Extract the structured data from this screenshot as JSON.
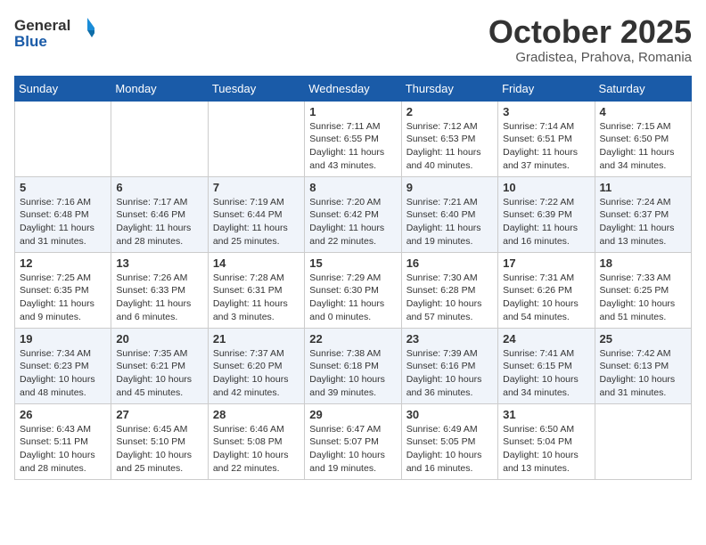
{
  "header": {
    "logo_line1": "General",
    "logo_line2": "Blue",
    "month": "October 2025",
    "location": "Gradistea, Prahova, Romania"
  },
  "days_of_week": [
    "Sunday",
    "Monday",
    "Tuesday",
    "Wednesday",
    "Thursday",
    "Friday",
    "Saturday"
  ],
  "weeks": [
    [
      {
        "day": "",
        "sunrise": "",
        "sunset": "",
        "daylight": ""
      },
      {
        "day": "",
        "sunrise": "",
        "sunset": "",
        "daylight": ""
      },
      {
        "day": "",
        "sunrise": "",
        "sunset": "",
        "daylight": ""
      },
      {
        "day": "1",
        "sunrise": "Sunrise: 7:11 AM",
        "sunset": "Sunset: 6:55 PM",
        "daylight": "Daylight: 11 hours and 43 minutes."
      },
      {
        "day": "2",
        "sunrise": "Sunrise: 7:12 AM",
        "sunset": "Sunset: 6:53 PM",
        "daylight": "Daylight: 11 hours and 40 minutes."
      },
      {
        "day": "3",
        "sunrise": "Sunrise: 7:14 AM",
        "sunset": "Sunset: 6:51 PM",
        "daylight": "Daylight: 11 hours and 37 minutes."
      },
      {
        "day": "4",
        "sunrise": "Sunrise: 7:15 AM",
        "sunset": "Sunset: 6:50 PM",
        "daylight": "Daylight: 11 hours and 34 minutes."
      }
    ],
    [
      {
        "day": "5",
        "sunrise": "Sunrise: 7:16 AM",
        "sunset": "Sunset: 6:48 PM",
        "daylight": "Daylight: 11 hours and 31 minutes."
      },
      {
        "day": "6",
        "sunrise": "Sunrise: 7:17 AM",
        "sunset": "Sunset: 6:46 PM",
        "daylight": "Daylight: 11 hours and 28 minutes."
      },
      {
        "day": "7",
        "sunrise": "Sunrise: 7:19 AM",
        "sunset": "Sunset: 6:44 PM",
        "daylight": "Daylight: 11 hours and 25 minutes."
      },
      {
        "day": "8",
        "sunrise": "Sunrise: 7:20 AM",
        "sunset": "Sunset: 6:42 PM",
        "daylight": "Daylight: 11 hours and 22 minutes."
      },
      {
        "day": "9",
        "sunrise": "Sunrise: 7:21 AM",
        "sunset": "Sunset: 6:40 PM",
        "daylight": "Daylight: 11 hours and 19 minutes."
      },
      {
        "day": "10",
        "sunrise": "Sunrise: 7:22 AM",
        "sunset": "Sunset: 6:39 PM",
        "daylight": "Daylight: 11 hours and 16 minutes."
      },
      {
        "day": "11",
        "sunrise": "Sunrise: 7:24 AM",
        "sunset": "Sunset: 6:37 PM",
        "daylight": "Daylight: 11 hours and 13 minutes."
      }
    ],
    [
      {
        "day": "12",
        "sunrise": "Sunrise: 7:25 AM",
        "sunset": "Sunset: 6:35 PM",
        "daylight": "Daylight: 11 hours and 9 minutes."
      },
      {
        "day": "13",
        "sunrise": "Sunrise: 7:26 AM",
        "sunset": "Sunset: 6:33 PM",
        "daylight": "Daylight: 11 hours and 6 minutes."
      },
      {
        "day": "14",
        "sunrise": "Sunrise: 7:28 AM",
        "sunset": "Sunset: 6:31 PM",
        "daylight": "Daylight: 11 hours and 3 minutes."
      },
      {
        "day": "15",
        "sunrise": "Sunrise: 7:29 AM",
        "sunset": "Sunset: 6:30 PM",
        "daylight": "Daylight: 11 hours and 0 minutes."
      },
      {
        "day": "16",
        "sunrise": "Sunrise: 7:30 AM",
        "sunset": "Sunset: 6:28 PM",
        "daylight": "Daylight: 10 hours and 57 minutes."
      },
      {
        "day": "17",
        "sunrise": "Sunrise: 7:31 AM",
        "sunset": "Sunset: 6:26 PM",
        "daylight": "Daylight: 10 hours and 54 minutes."
      },
      {
        "day": "18",
        "sunrise": "Sunrise: 7:33 AM",
        "sunset": "Sunset: 6:25 PM",
        "daylight": "Daylight: 10 hours and 51 minutes."
      }
    ],
    [
      {
        "day": "19",
        "sunrise": "Sunrise: 7:34 AM",
        "sunset": "Sunset: 6:23 PM",
        "daylight": "Daylight: 10 hours and 48 minutes."
      },
      {
        "day": "20",
        "sunrise": "Sunrise: 7:35 AM",
        "sunset": "Sunset: 6:21 PM",
        "daylight": "Daylight: 10 hours and 45 minutes."
      },
      {
        "day": "21",
        "sunrise": "Sunrise: 7:37 AM",
        "sunset": "Sunset: 6:20 PM",
        "daylight": "Daylight: 10 hours and 42 minutes."
      },
      {
        "day": "22",
        "sunrise": "Sunrise: 7:38 AM",
        "sunset": "Sunset: 6:18 PM",
        "daylight": "Daylight: 10 hours and 39 minutes."
      },
      {
        "day": "23",
        "sunrise": "Sunrise: 7:39 AM",
        "sunset": "Sunset: 6:16 PM",
        "daylight": "Daylight: 10 hours and 36 minutes."
      },
      {
        "day": "24",
        "sunrise": "Sunrise: 7:41 AM",
        "sunset": "Sunset: 6:15 PM",
        "daylight": "Daylight: 10 hours and 34 minutes."
      },
      {
        "day": "25",
        "sunrise": "Sunrise: 7:42 AM",
        "sunset": "Sunset: 6:13 PM",
        "daylight": "Daylight: 10 hours and 31 minutes."
      }
    ],
    [
      {
        "day": "26",
        "sunrise": "Sunrise: 6:43 AM",
        "sunset": "Sunset: 5:11 PM",
        "daylight": "Daylight: 10 hours and 28 minutes."
      },
      {
        "day": "27",
        "sunrise": "Sunrise: 6:45 AM",
        "sunset": "Sunset: 5:10 PM",
        "daylight": "Daylight: 10 hours and 25 minutes."
      },
      {
        "day": "28",
        "sunrise": "Sunrise: 6:46 AM",
        "sunset": "Sunset: 5:08 PM",
        "daylight": "Daylight: 10 hours and 22 minutes."
      },
      {
        "day": "29",
        "sunrise": "Sunrise: 6:47 AM",
        "sunset": "Sunset: 5:07 PM",
        "daylight": "Daylight: 10 hours and 19 minutes."
      },
      {
        "day": "30",
        "sunrise": "Sunrise: 6:49 AM",
        "sunset": "Sunset: 5:05 PM",
        "daylight": "Daylight: 10 hours and 16 minutes."
      },
      {
        "day": "31",
        "sunrise": "Sunrise: 6:50 AM",
        "sunset": "Sunset: 5:04 PM",
        "daylight": "Daylight: 10 hours and 13 minutes."
      },
      {
        "day": "",
        "sunrise": "",
        "sunset": "",
        "daylight": ""
      }
    ]
  ]
}
